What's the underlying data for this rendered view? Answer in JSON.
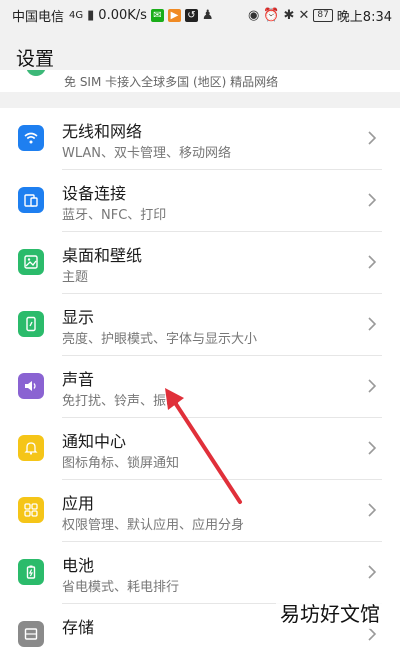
{
  "status_bar": {
    "carrier": "中国电信",
    "signal": "4G",
    "speed": "0.00K/s",
    "battery": "87",
    "time": "晚上8:34"
  },
  "header": {
    "title": "设置"
  },
  "peek_row": {
    "text": "免 SIM 卡接入全球多国 (地区) 精品网络"
  },
  "settings": [
    {
      "title": "无线和网络",
      "subtitle": "WLAN、双卡管理、移动网络",
      "icon": "wifi-icon",
      "color": "#1e7ff0"
    },
    {
      "title": "设备连接",
      "subtitle": "蓝牙、NFC、打印",
      "icon": "device-connection-icon",
      "color": "#1e7ff0"
    },
    {
      "title": "桌面和壁纸",
      "subtitle": "主题",
      "icon": "wallpaper-icon",
      "color": "#2bbb6b"
    },
    {
      "title": "显示",
      "subtitle": "亮度、护眼模式、字体与显示大小",
      "icon": "display-icon",
      "color": "#2bbb6b"
    },
    {
      "title": "声音",
      "subtitle": "免打扰、铃声、振动",
      "icon": "sound-icon",
      "color": "#8a63d2"
    },
    {
      "title": "通知中心",
      "subtitle": "图标角标、锁屏通知",
      "icon": "notification-bell-icon",
      "color": "#f5c518"
    },
    {
      "title": "应用",
      "subtitle": "权限管理、默认应用、应用分身",
      "icon": "apps-icon",
      "color": "#f5c518"
    },
    {
      "title": "电池",
      "subtitle": "省电模式、耗电排行",
      "icon": "battery-icon",
      "color": "#2bbb6b"
    },
    {
      "title": "存储",
      "subtitle": "",
      "icon": "storage-icon",
      "color": "#8a8a8a"
    }
  ],
  "watermark": "易坊好文馆"
}
